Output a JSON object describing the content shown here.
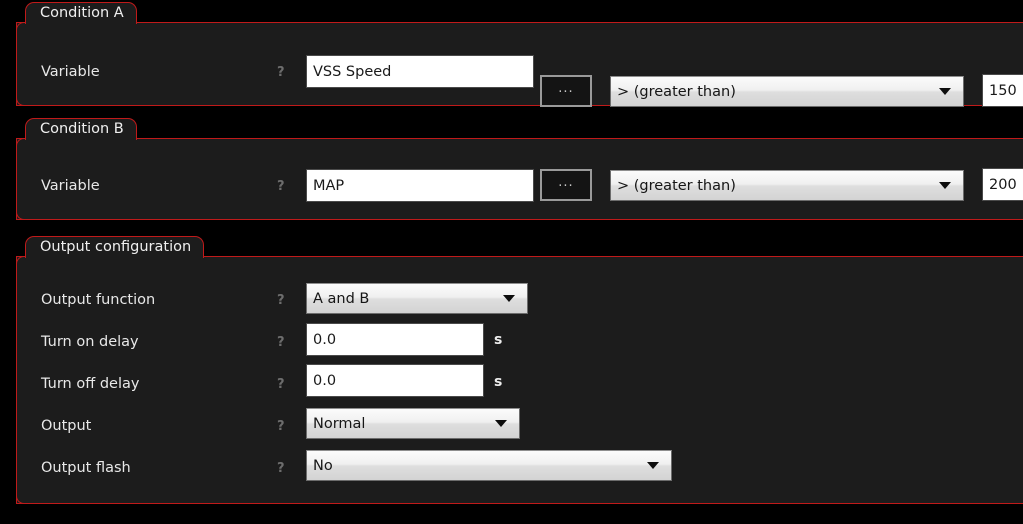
{
  "app": {
    "background": "#000000",
    "panel_background": "#1c1c1c",
    "accent": "#c01a1a",
    "text_color": "#e8e8e8"
  },
  "panels": [
    {
      "title": "Condition A",
      "rows": [
        {
          "label": "Variable",
          "help": "?",
          "variable_value": "VSS Speed",
          "browse_label": "...",
          "comparison": "> (greater than)",
          "threshold": "150"
        }
      ]
    },
    {
      "title": "Condition B",
      "rows": [
        {
          "label": "Variable",
          "help": "?",
          "variable_value": "MAP",
          "browse_label": "...",
          "comparison": "> (greater than)",
          "threshold": "200"
        }
      ]
    },
    {
      "title": "Output configuration",
      "rows": [
        {
          "label": "Output function",
          "help": "?",
          "value": "A and B",
          "widget": "combo",
          "unit": ""
        },
        {
          "label": "Turn on delay",
          "help": "?",
          "value": "0.0",
          "widget": "textbox",
          "unit": "s"
        },
        {
          "label": "Turn off delay",
          "help": "?",
          "value": "0.0",
          "widget": "textbox",
          "unit": "s"
        },
        {
          "label": "Output",
          "help": "?",
          "value": "Normal",
          "widget": "combo",
          "unit": ""
        },
        {
          "label": "Output flash",
          "help": "?",
          "value": "No",
          "widget": "combo",
          "unit": ""
        }
      ]
    }
  ]
}
